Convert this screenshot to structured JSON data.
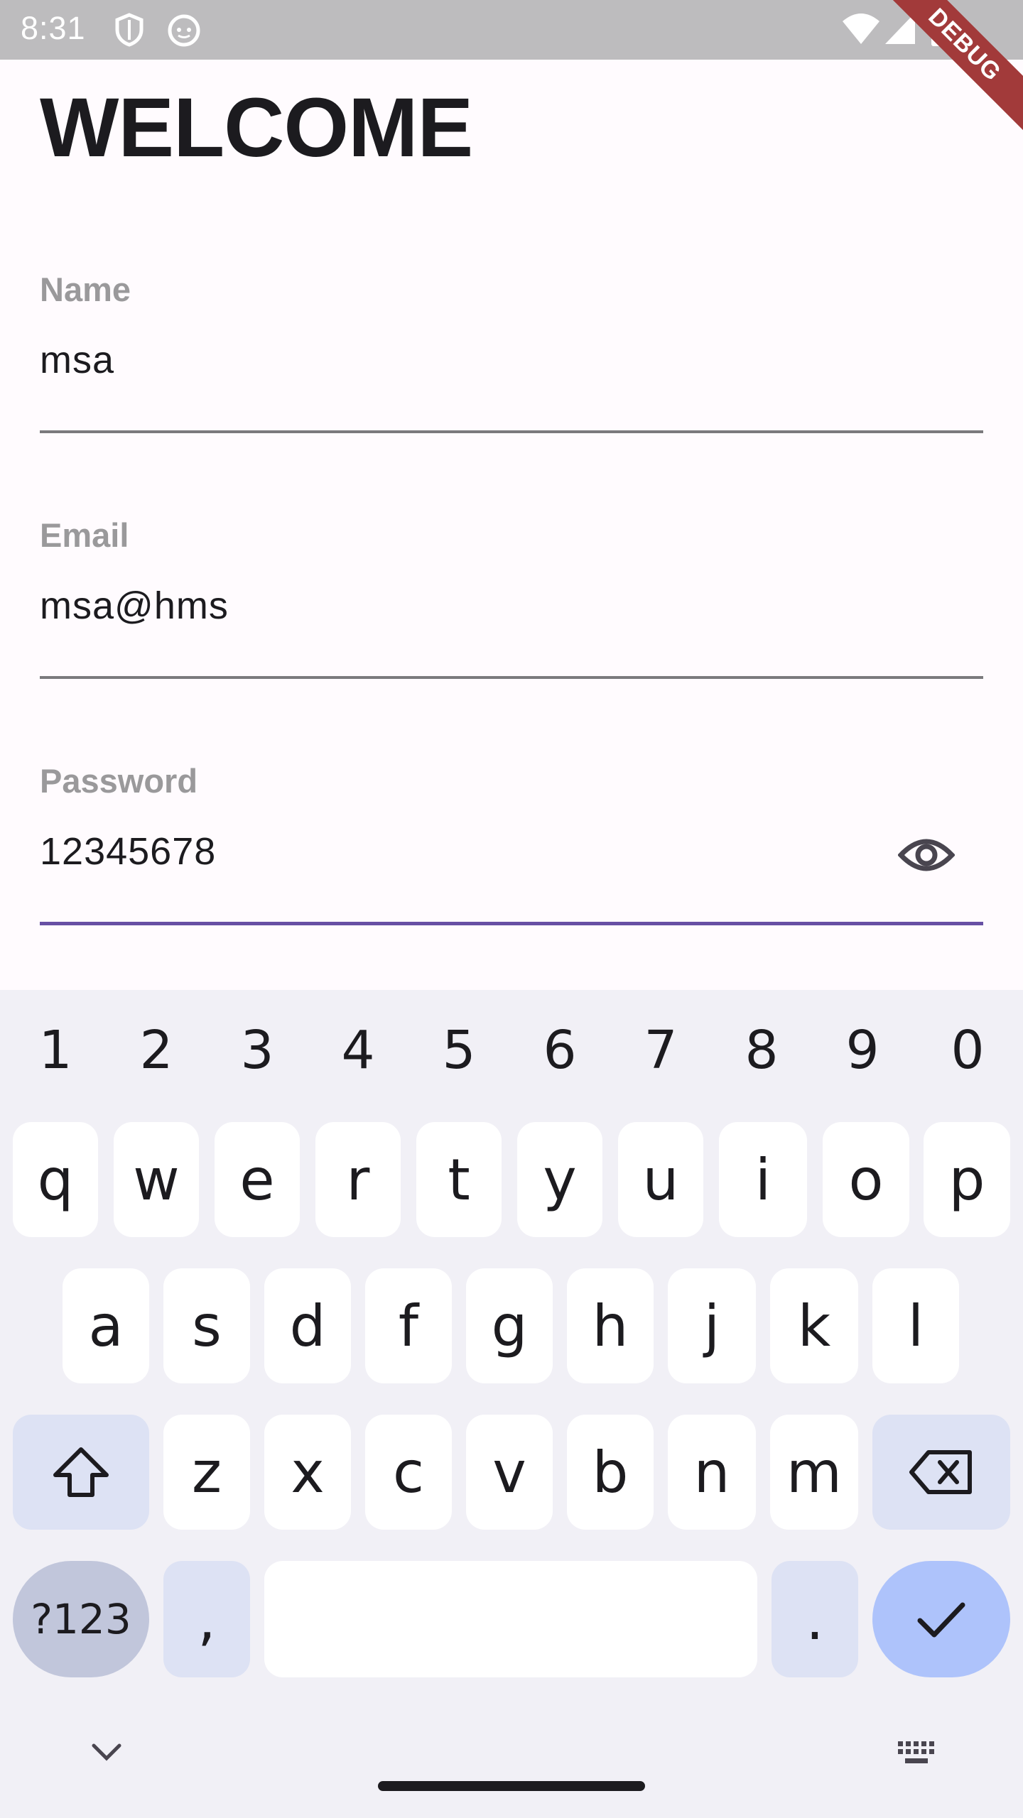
{
  "status_bar": {
    "time": "8:31",
    "icons": [
      "shield-icon",
      "cat-icon",
      "wifi-icon",
      "signal-icon",
      "battery-icon"
    ]
  },
  "debug_banner": "DEBUG",
  "form": {
    "title": "WELCOME",
    "name": {
      "label": "Name",
      "value": "msa"
    },
    "email": {
      "label": "Email",
      "value": "msa@hms"
    },
    "password": {
      "label": "Password",
      "value": "12345678",
      "toggle_icon": "eye-icon"
    }
  },
  "keyboard": {
    "numbers": [
      "1",
      "2",
      "3",
      "4",
      "5",
      "6",
      "7",
      "8",
      "9",
      "0"
    ],
    "row1": [
      "q",
      "w",
      "e",
      "r",
      "t",
      "y",
      "u",
      "i",
      "o",
      "p"
    ],
    "row2": [
      "a",
      "s",
      "d",
      "f",
      "g",
      "h",
      "j",
      "k",
      "l"
    ],
    "row3": [
      "z",
      "x",
      "c",
      "v",
      "b",
      "n",
      "m"
    ],
    "symbols_label": "?123",
    "comma": ",",
    "period": ".",
    "icons": [
      "shift-icon",
      "backspace-icon",
      "checkmark-icon",
      "chevron-down-icon",
      "keyboard-icon"
    ]
  },
  "colors": {
    "accent": "#6750a4",
    "background": "#fffbfe",
    "keyboard_bg": "#f1f0f6",
    "enter_key": "#aec3fb",
    "debug_banner": "#a23a3a"
  }
}
